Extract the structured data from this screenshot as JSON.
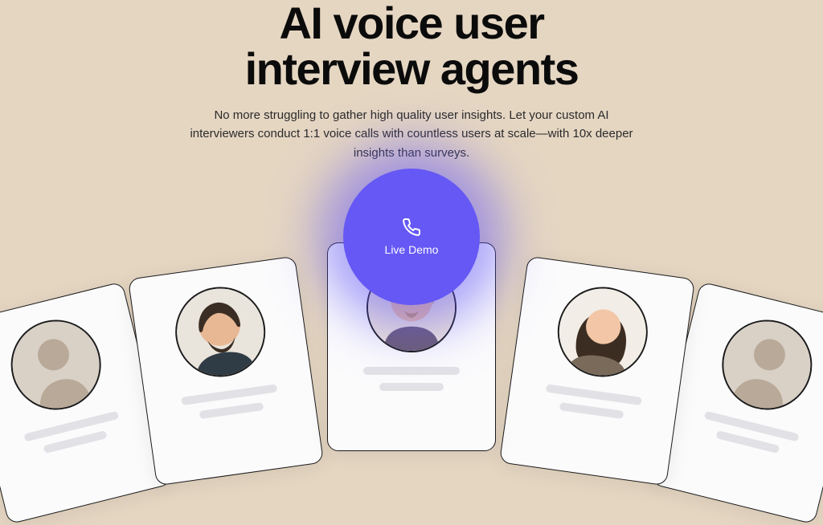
{
  "headline_line1": "AI voice user",
  "headline_line2": "interview agents",
  "subhead": "No more struggling to gather high quality user insights. Let your custom AI interviewers conduct 1:1 voice calls with countless users at scale—with 10x deeper insights than surveys.",
  "demo_label": "Live Demo",
  "colors": {
    "accent": "#6558f5",
    "bg": "#e5d6c2",
    "text": "#0b0b0b"
  },
  "cards": [
    {
      "position": "left2",
      "avatar": "placeholder"
    },
    {
      "position": "left1",
      "avatar": "man-beard"
    },
    {
      "position": "center",
      "avatar": "woman-blonde"
    },
    {
      "position": "right1",
      "avatar": "woman-brunette"
    },
    {
      "position": "right2",
      "avatar": "placeholder"
    }
  ]
}
